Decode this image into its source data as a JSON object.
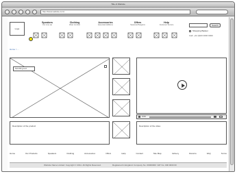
{
  "window": {
    "title": "Title of Website"
  },
  "browser": {
    "url": "http://www.website.com/"
  },
  "header": {
    "logo": "Logo",
    "nav": [
      {
        "label": "Speakers",
        "sub": "Our Line-Up"
      },
      {
        "label": "Clothing",
        "sub": "Wear Comfort"
      },
      {
        "label": "Accessories",
        "sub": "Essential Additions"
      },
      {
        "label": "Offers",
        "sub": "Seasonal Bargains"
      },
      {
        "label": "Help",
        "sub": "Customer Service"
      }
    ],
    "search_placeholder": "",
    "search_button": "Search",
    "basket": "Shopping Basket",
    "phone": "Call: +44 (0)00 0000 0000"
  },
  "breadcrumb": "Home > ...",
  "hero": {
    "caption": "Scrolling text"
  },
  "video": {
    "time": "0:00"
  },
  "captions": {
    "left": "Description of the product",
    "right": "Description of the video"
  },
  "footer": {
    "links": [
      "Home",
      "Our Products",
      "Speakers",
      "Clothing",
      "Accessories",
      "Offers",
      "Help",
      "Contact",
      "Site Map",
      "Delivery",
      "Returns",
      "FAQ",
      "Terms"
    ],
    "copyright": "Website Name Limited. Copyright © 2011. All Rights Reserved.",
    "legal": "Registered in England. Company No. 00000000. VAT No. 000 0000 00"
  }
}
